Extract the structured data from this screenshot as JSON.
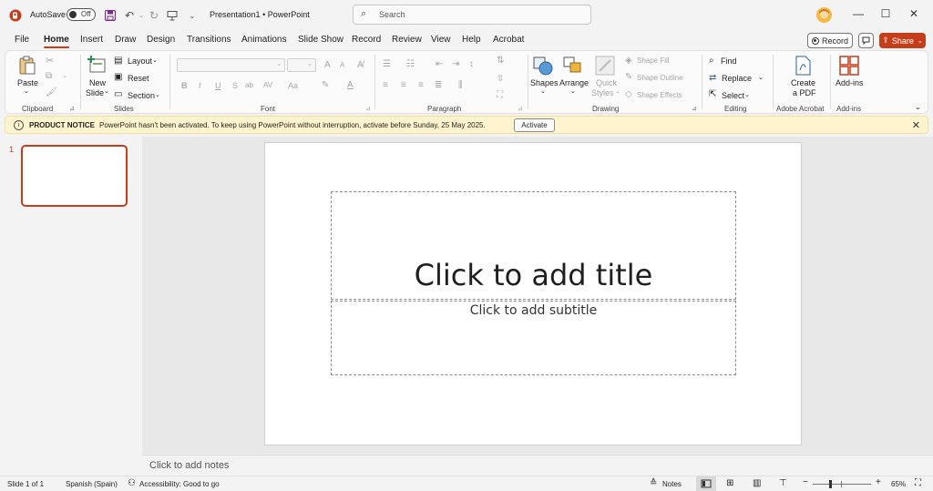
{
  "titlebar": {
    "autosave_label": "AutoSave",
    "autosave_state": "Off",
    "document_title": "Presentation1",
    "separator": "•",
    "app_name": "PowerPoint",
    "search_placeholder": "Search"
  },
  "tabs": [
    "File",
    "Home",
    "Insert",
    "Draw",
    "Design",
    "Transitions",
    "Animations",
    "Slide Show",
    "Record",
    "Review",
    "View",
    "Help",
    "Acrobat"
  ],
  "actions": {
    "record": "Record",
    "share": "Share"
  },
  "ribbon": {
    "clipboard": {
      "paste": "Paste",
      "group": "Clipboard"
    },
    "slides": {
      "new_slide_1": "New",
      "new_slide_2": "Slide",
      "layout": "Layout",
      "reset": "Reset",
      "section": "Section",
      "group": "Slides"
    },
    "font": {
      "group": "Font",
      "bold": "B",
      "italic": "I",
      "underline": "U",
      "strike": "S",
      "spacing": "AV",
      "case": "Aa",
      "grow": "A",
      "shrink": "A"
    },
    "paragraph": {
      "group": "Paragraph"
    },
    "drawing": {
      "shapes": "Shapes",
      "arrange": "Arrange",
      "quick_styles_1": "Quick",
      "quick_styles_2": "Styles",
      "shape_fill": "Shape Fill",
      "shape_outline": "Shape Outline",
      "shape_effects": "Shape Effects",
      "group": "Drawing"
    },
    "editing": {
      "find": "Find",
      "replace": "Replace",
      "select": "Select",
      "group": "Editing"
    },
    "acrobat": {
      "create_1": "Create",
      "create_2": "a PDF",
      "group": "Adobe Acrobat"
    },
    "addins": {
      "label": "Add-ins",
      "group": "Add-ins"
    }
  },
  "notice": {
    "title": "PRODUCT NOTICE",
    "message": "PowerPoint hasn't been activated. To keep using PowerPoint without interruption, activate before Sunday, 25 May 2025.",
    "button": "Activate"
  },
  "thumbnail": {
    "number": "1"
  },
  "slide": {
    "title_placeholder": "Click to add title",
    "subtitle_placeholder": "Click to add subtitle"
  },
  "notes_placeholder": "Click to add notes",
  "status": {
    "slide": "Slide 1 of 1",
    "language": "Spanish (Spain)",
    "accessibility": "Accessibility: Good to go",
    "notes": "Notes",
    "zoom": "65%",
    "zoom_level": 0.65
  },
  "colors": {
    "accent": "#c43e1c",
    "notice_bg": "#fff4ce"
  }
}
